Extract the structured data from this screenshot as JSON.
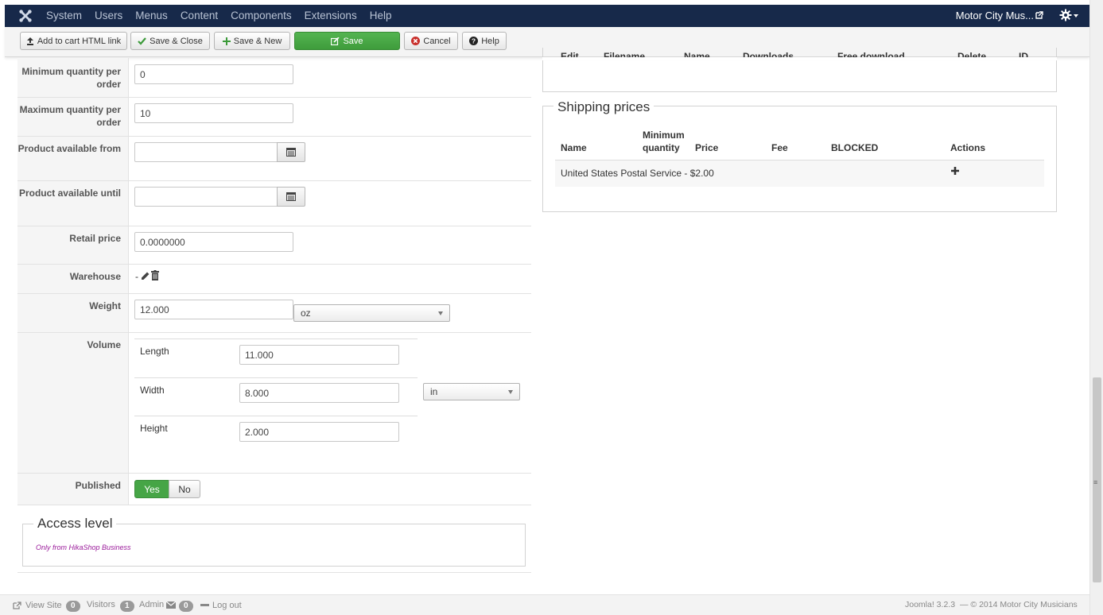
{
  "topnav": {
    "menu": [
      "System",
      "Users",
      "Menus",
      "Content",
      "Components",
      "Extensions",
      "Help"
    ],
    "site_name": "Motor City Mus..."
  },
  "toolbar": {
    "add_to_cart": "Add to cart HTML link",
    "save_close": "Save & Close",
    "save_new": "Save & New",
    "save": "Save",
    "cancel": "Cancel",
    "help": "Help"
  },
  "form": {
    "min_qty": {
      "label": "Minimum quantity per order",
      "value": "0"
    },
    "max_qty": {
      "label": "Maximum quantity per order",
      "value": "10"
    },
    "available_from": {
      "label": "Product available from",
      "value": ""
    },
    "available_until": {
      "label": "Product available until",
      "value": ""
    },
    "retail_price": {
      "label": "Retail price",
      "value": "0.0000000"
    },
    "warehouse": {
      "label": "Warehouse",
      "value": "-"
    },
    "weight": {
      "label": "Weight",
      "value": "12.000",
      "unit": "oz"
    },
    "volume": {
      "label": "Volume",
      "length_label": "Length",
      "length": "11.000",
      "width_label": "Width",
      "width": "8.000",
      "height_label": "Height",
      "height": "2.000",
      "unit": "in"
    },
    "published": {
      "label": "Published",
      "yes": "Yes",
      "no": "No"
    }
  },
  "access_level": {
    "title": "Access level",
    "text": "Only from HikaShop Business"
  },
  "files_header_partial": [
    "Edit",
    "Filename",
    "Name",
    "Downloads",
    "Free download",
    "Delete",
    "ID"
  ],
  "shipping": {
    "title": "Shipping prices",
    "columns": [
      "Name",
      "Minimum quantity",
      "Price",
      "Fee",
      "BLOCKED",
      "Actions"
    ],
    "rows": [
      {
        "name": "United States Postal Service - $2.00"
      }
    ]
  },
  "footer": {
    "view_site": "View Site",
    "visitors_count": "0",
    "visitors": "Visitors",
    "admin_count": "1",
    "admin": "Admin",
    "messages_count": "0",
    "logout": "Log out",
    "version": "Joomla! 3.2.3",
    "copyright": "— © 2014 Motor City Musicians"
  },
  "colors": {
    "nav": "#17294a",
    "green": "#46a546",
    "link_purple": "#9b1c9b"
  }
}
